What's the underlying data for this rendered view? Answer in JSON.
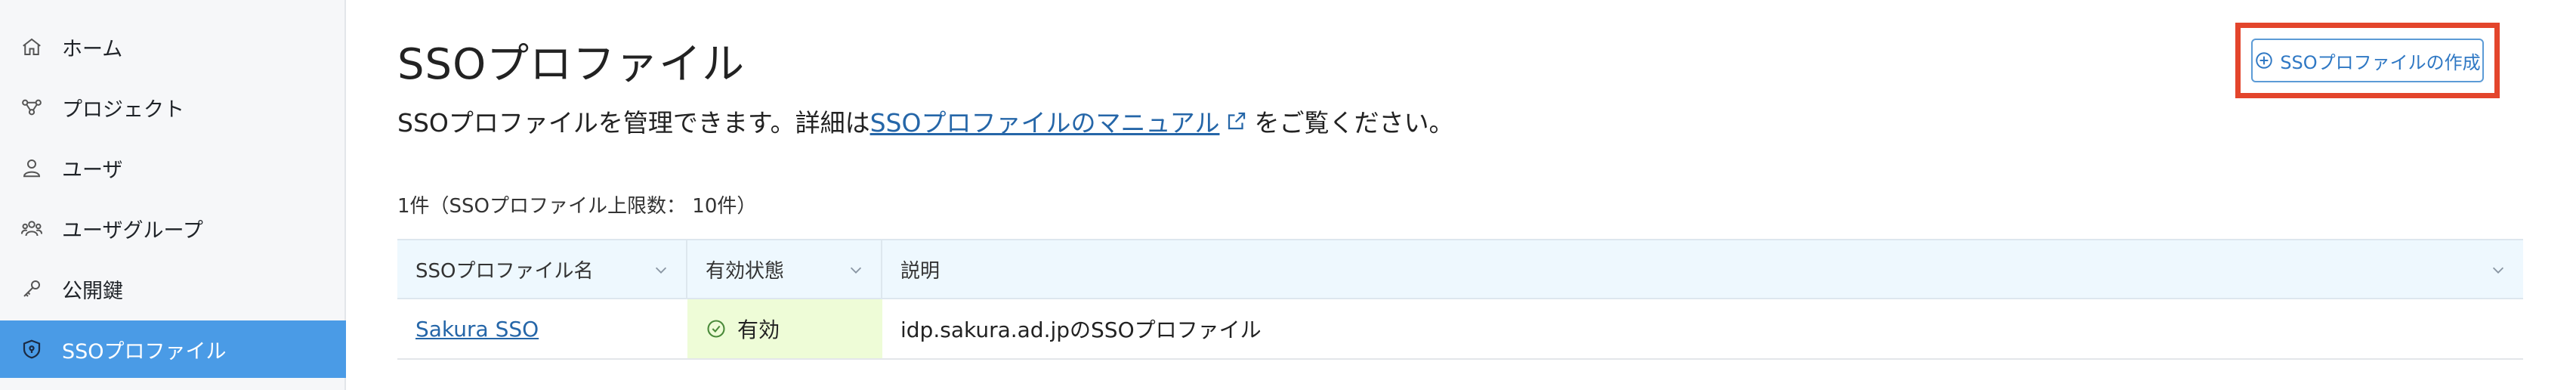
{
  "sidebar": {
    "items": [
      {
        "label": "ホーム",
        "icon": "home-icon"
      },
      {
        "label": "プロジェクト",
        "icon": "project-icon"
      },
      {
        "label": "ユーザ",
        "icon": "user-icon"
      },
      {
        "label": "ユーザグループ",
        "icon": "user-group-icon"
      },
      {
        "label": "公開鍵",
        "icon": "key-icon"
      },
      {
        "label": "SSOプロファイル",
        "icon": "shield-icon",
        "active": true
      }
    ]
  },
  "page": {
    "title": "SSOプロファイル",
    "desc_prefix": "SSOプロファイルを管理できます。詳細は",
    "desc_link": "SSOプロファイルのマニュアル",
    "desc_suffix": "をご覧ください。",
    "create_button": "SSOプロファイルの作成",
    "count_text": "1件（SSOプロファイル上限数： 10件）"
  },
  "table": {
    "headers": [
      "SSOプロファイル名",
      "有効状態",
      "説明"
    ],
    "rows": [
      {
        "name": "Sakura SSO",
        "status": "有効",
        "description": "idp.sakura.ad.jpのSSOプロファイル"
      }
    ]
  },
  "colors": {
    "accent": "#4a9be6",
    "highlight_border": "#e3452c",
    "link": "#2566a8",
    "status_bg": "#eefcd7"
  }
}
